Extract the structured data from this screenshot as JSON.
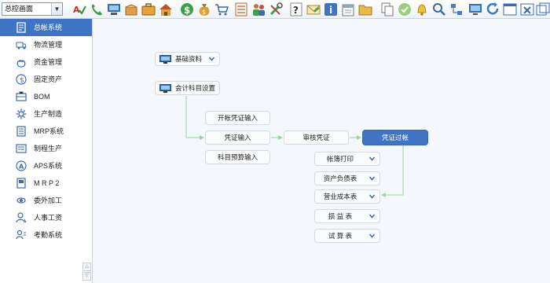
{
  "toolbar": {
    "screen_select": "总控画面",
    "icons": [
      "spell-check-icon",
      "phone-icon",
      "computer-icon",
      "open-box-icon",
      "briefcase-icon",
      "home-icon",
      "dollar-icon",
      "money-bag-icon",
      "cart-icon",
      "checklist-icon",
      "users-icon",
      "tools-icon",
      "help-icon",
      "mail-icon",
      "info-icon",
      "calendar-icon",
      "folder-icon",
      "copy-icon",
      "check-circle-icon",
      "bell-icon",
      "search-icon",
      "network-icon",
      "monitor-icon",
      "refresh-icon",
      "window-icon",
      "close-window-icon",
      "restore-icon"
    ]
  },
  "sidebar": {
    "items": [
      {
        "label": "总帐系统",
        "icon": "ledger-icon"
      },
      {
        "label": "物流管理",
        "icon": "truck-icon"
      },
      {
        "label": "资金管理",
        "icon": "money-pot-icon"
      },
      {
        "label": "固定资产",
        "icon": "asset-icon"
      },
      {
        "label": "BOM",
        "icon": "bom-icon"
      },
      {
        "label": "生产制造",
        "icon": "gear-icon"
      },
      {
        "label": "MRP系统",
        "icon": "mrp-icon"
      },
      {
        "label": "制程生产",
        "icon": "process-icon"
      },
      {
        "label": "APS系统",
        "icon": "aps-icon"
      },
      {
        "label": "M R P 2",
        "icon": "mrp2-icon"
      },
      {
        "label": "委外加工",
        "icon": "outsource-icon"
      },
      {
        "label": "人事工资",
        "icon": "person-icon"
      },
      {
        "label": "考勤系统",
        "icon": "attendance-icon"
      }
    ],
    "active_index": 0
  },
  "flow": {
    "basic_data": "基础资料",
    "account_setup": "会计科目设置",
    "opening_voucher": "开帐凭证输入",
    "voucher_input": "凭证输入",
    "budget_input": "科目预算输入",
    "audit_voucher": "审核凭证",
    "voucher_posting": "凭证过帐",
    "ledger_print": "帐簿打印",
    "balance_sheet": "资产负债表",
    "cost_sheet": "营业成本表",
    "profit_loss": "损 益 表",
    "trial_balance": "试 算 表"
  },
  "colors": {
    "accent": "#3f74c4",
    "connector": "#98d89a",
    "canvas": "#f4f7fb"
  }
}
